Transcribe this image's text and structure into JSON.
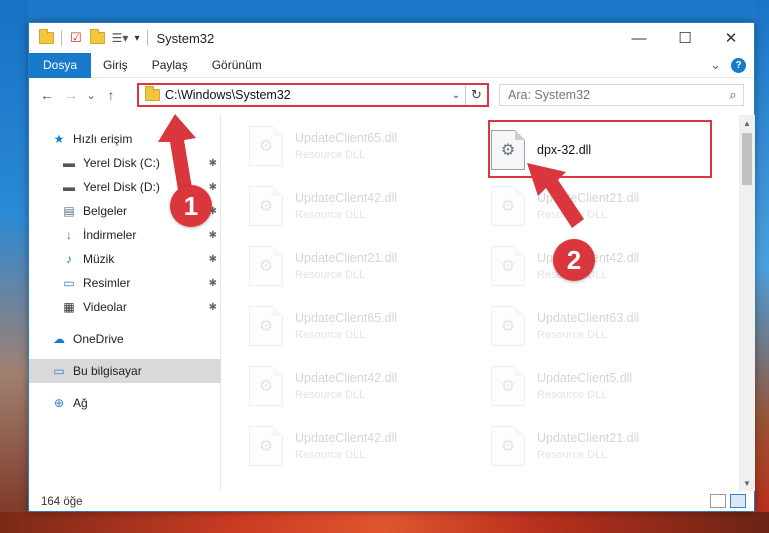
{
  "window": {
    "title": "System32",
    "controls": {
      "minimize": "—",
      "maximize": "☐",
      "close": "✕"
    }
  },
  "ribbon": {
    "tabs": [
      "Dosya",
      "Giriş",
      "Paylaş",
      "Görünüm"
    ],
    "expand_glyph": "⌄",
    "help_glyph": "?"
  },
  "nav": {
    "back": "←",
    "forward": "→",
    "recent": "⌄",
    "up": "↑",
    "address": "C:\\Windows\\System32",
    "search_placeholder": "Ara: System32"
  },
  "sidebar": {
    "items": [
      {
        "label": "Hızlı erişim",
        "icon": "star-icon",
        "glyph": "★",
        "color": "#1979ca",
        "pinned": false
      },
      {
        "label": "Yerel Disk (C:)",
        "icon": "drive-icon",
        "glyph": "▬",
        "color": "#555555",
        "pinned": true
      },
      {
        "label": "Yerel Disk (D:)",
        "icon": "drive-icon",
        "glyph": "▬",
        "color": "#555555",
        "pinned": true
      },
      {
        "label": "Belgeler",
        "icon": "documents-icon",
        "glyph": "▤",
        "color": "#5a6f86",
        "pinned": true
      },
      {
        "label": "İndirmeler",
        "icon": "download-icon",
        "glyph": "↓",
        "color": "#1979ca",
        "pinned": true
      },
      {
        "label": "Müzik",
        "icon": "music-icon",
        "glyph": "♪",
        "color": "#1979ca",
        "pinned": true
      },
      {
        "label": "Resimler",
        "icon": "pictures-icon",
        "glyph": "▭",
        "color": "#3a7abf",
        "pinned": true
      },
      {
        "label": "Videolar",
        "icon": "video-icon",
        "glyph": "▦",
        "color": "#333333",
        "pinned": true
      },
      {
        "label": "OneDrive",
        "icon": "cloud-icon",
        "glyph": "☁",
        "color": "#1979ca",
        "pinned": false
      },
      {
        "label": "Bu bilgisayar",
        "icon": "computer-icon",
        "glyph": "▭",
        "color": "#2a7fd0",
        "pinned": false,
        "selected": true
      },
      {
        "label": "Ağ",
        "icon": "network-icon",
        "glyph": "⊕",
        "color": "#2a7fd0",
        "pinned": false
      }
    ],
    "pin_glyph": "📌"
  },
  "files": {
    "type_label": "Resource DLL",
    "left_column": [
      "UpdateClient65.dll",
      "UpdateClient42.dll",
      "UpdateClient21.dll",
      "UpdateClient65.dll",
      "UpdateClient42.dll",
      "UpdateClient42.dll"
    ],
    "right_column": [
      "dpx-32.dll",
      "UpdateClient21.dll",
      "UpdateClient42.dll",
      "UpdateClient63.dll",
      "UpdateClient5.dll",
      "UpdateClient21.dll"
    ],
    "highlighted": "dpx-32.dll"
  },
  "status": {
    "item_count": "164 öğe"
  },
  "callouts": [
    "1",
    "2"
  ],
  "colors": {
    "accent": "#1979ca",
    "highlight": "#d9363e"
  }
}
